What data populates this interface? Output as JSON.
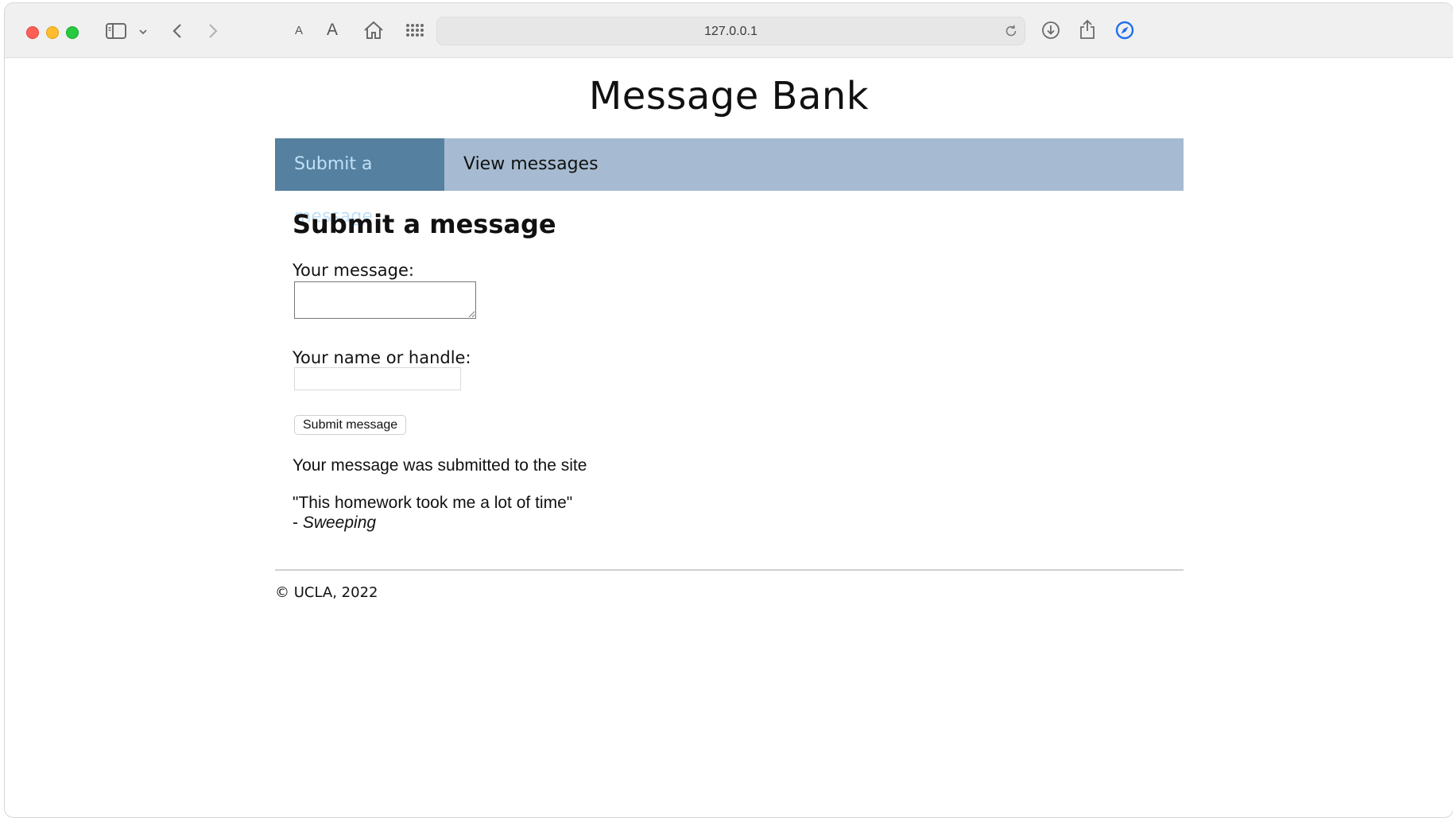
{
  "browser": {
    "url": "127.0.0.1",
    "font_small_label": "A",
    "font_large_label": "A"
  },
  "page": {
    "site_title": "Message Bank",
    "nav": {
      "tabs": [
        {
          "label": "Submit a message",
          "active": true
        },
        {
          "label": "View messages",
          "active": false
        }
      ]
    },
    "form": {
      "heading": "Submit a message",
      "message_label": "Your message:",
      "message_value": "",
      "name_label": "Your name or handle:",
      "name_value": "",
      "submit_label": "Submit message"
    },
    "confirmation": {
      "status_text": "Your message was submitted to the site",
      "quote_text": "\"This homework took me a lot of time\"",
      "author_prefix": "- ",
      "author": "Sweeping"
    },
    "footer": {
      "copyright": "© UCLA, 2022"
    }
  },
  "colors": {
    "nav_bg": "#a6bbd1",
    "nav_active_bg": "#56809f",
    "nav_active_text": "#bfe0f8"
  }
}
